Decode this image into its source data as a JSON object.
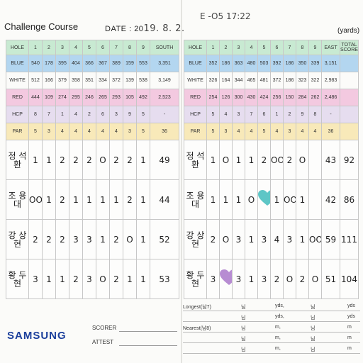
{
  "title": "Challenge Course",
  "date_label": "DATE : 20",
  "date_handwritten": "19. 8. 2.",
  "handwritten_top": "E -O5  17:22",
  "yards_label": "(yards)",
  "front": {
    "holes": [
      "HOLE",
      "1",
      "2",
      "3",
      "4",
      "5",
      "6",
      "7",
      "8",
      "9",
      "SOUTH"
    ],
    "blue": [
      "BLUE",
      "540",
      "178",
      "395",
      "404",
      "366",
      "367",
      "389",
      "159",
      "553",
      "3,351"
    ],
    "white": [
      "WHITE",
      "512",
      "166",
      "379",
      "358",
      "351",
      "334",
      "372",
      "139",
      "538",
      "3,149"
    ],
    "red": [
      "RED",
      "444",
      "109",
      "274",
      "295",
      "246",
      "265",
      "293",
      "105",
      "492",
      "2,523"
    ],
    "hcp": [
      "HCP",
      "8",
      "7",
      "1",
      "4",
      "2",
      "6",
      "3",
      "9",
      "5",
      "-"
    ],
    "par": [
      "PAR",
      "5",
      "3",
      "4",
      "4",
      "4",
      "4",
      "4",
      "3",
      "5",
      "36"
    ]
  },
  "back": {
    "holes": [
      "HOLE",
      "1",
      "2",
      "3",
      "4",
      "5",
      "6",
      "7",
      "8",
      "9",
      "EAST",
      "TOTAL SCORE"
    ],
    "blue": [
      "BLUE",
      "352",
      "186",
      "363",
      "480",
      "503",
      "392",
      "186",
      "350",
      "339",
      "3,151",
      ""
    ],
    "white": [
      "WHITE",
      "326",
      "164",
      "344",
      "465",
      "481",
      "372",
      "186",
      "323",
      "322",
      "2,983",
      ""
    ],
    "red": [
      "RED",
      "254",
      "126",
      "300",
      "430",
      "424",
      "256",
      "150",
      "284",
      "262",
      "2,486",
      ""
    ],
    "hcp": [
      "HCP",
      "5",
      "4",
      "3",
      "7",
      "6",
      "1",
      "2",
      "9",
      "8",
      "-",
      ""
    ],
    "par": [
      "PAR",
      "5",
      "3",
      "4",
      "4",
      "5",
      "4",
      "3",
      "4",
      "4",
      "36",
      ""
    ]
  },
  "players": [
    {
      "name": "정 석환",
      "front": [
        "1",
        "1",
        "2",
        "2",
        "2",
        "O",
        "2",
        "2",
        "1",
        "49"
      ],
      "back": [
        "1",
        "O",
        "1",
        "1",
        "2",
        "OO",
        "2",
        "O",
        "",
        "43",
        "92"
      ]
    },
    {
      "name": "조 용대",
      "front": [
        "OO",
        "1",
        "2",
        "1",
        "1",
        "1",
        "1",
        "2",
        "1",
        "44"
      ],
      "back": [
        "1",
        "1",
        "1",
        "O",
        "♥",
        "1",
        "OO",
        "1",
        "",
        "42",
        "86"
      ]
    },
    {
      "name": "강 상현",
      "front": [
        "2",
        "2",
        "2",
        "3",
        "3",
        "1",
        "2",
        "O",
        "1",
        "52"
      ],
      "back": [
        "2",
        "O",
        "3",
        "1",
        "3",
        "4",
        "3",
        "1",
        "OO",
        "59",
        "111"
      ]
    },
    {
      "name": "황 두현",
      "front": [
        "3",
        "1",
        "1",
        "2",
        "3",
        "O",
        "2",
        "1",
        "1",
        "53"
      ],
      "back": [
        "3",
        "♥",
        "3",
        "1",
        "3",
        "2",
        "O",
        "2",
        "O",
        "51",
        "104"
      ]
    }
  ],
  "footer": {
    "longest": "Longest(남7)",
    "nearest": "Nearest(남8)",
    "unit_nim": "님",
    "unit_yds": "yds,",
    "unit_yds_end": "yds",
    "unit_m": "m,",
    "unit_m_end": "m",
    "brand": "SAMSUNG",
    "scorer": "SCORER",
    "attest": "ATTEST"
  },
  "colors": {
    "brand": "#1b3f9c",
    "blue_row": "#b3d6f0",
    "red_row": "#f3c9e0",
    "par_row": "#f8e9b9",
    "hole_row": "#c8ead2",
    "hcp_row": "#e6ddef",
    "heart_teal": "#5ec6c6",
    "heart_purple": "#b78cd2"
  }
}
